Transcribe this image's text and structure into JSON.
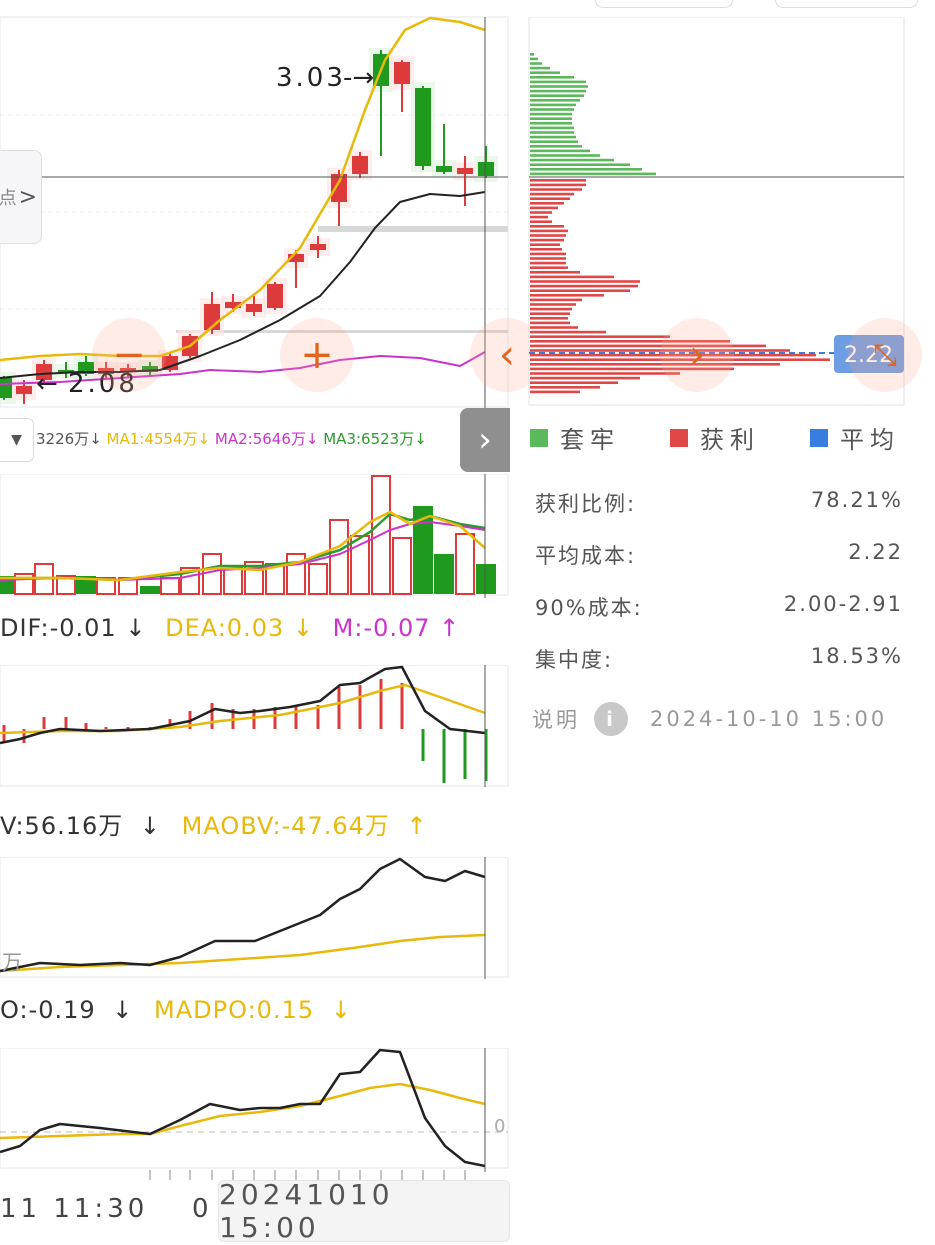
{
  "colors": {
    "up": "#dd3b3b",
    "down": "#1f9a1f",
    "ma_yellow": "#e8b90c",
    "ma_magenta": "#cc33cc",
    "ma_green": "#2e9a2e",
    "accent_orange": "#e0641e",
    "avg_blue": "#3a7de0",
    "chip_green": "#5bb85b",
    "chip_red": "#e04848"
  },
  "kline": {
    "high_label": "3.03",
    "low_label": "2.08",
    "chip_price_tag": "2.22"
  },
  "volume": {
    "vol_text": "3226万",
    "ma1_text": "MA1:4554万",
    "ma2_text": "MA2:5646万",
    "ma3_text": "MA3:6523万",
    "dropdown_icon": "triangle-down-icon"
  },
  "macd": {
    "dif": "DIF:-0.01",
    "dea": "DEA:0.03",
    "m": "M:-0.07"
  },
  "obv": {
    "obv": "V:56.16万",
    "maobv": "MAOBV:-47.64万",
    "unit_label": "万"
  },
  "dpo": {
    "dpo": "O:-0.19",
    "madpo": "MADPO:0.15",
    "zero_label": "0"
  },
  "side_tab_text": "点",
  "time_axis": {
    "left_label": "11 11:30",
    "mid_fragment": "0",
    "crosshair_label": "20241010 15:00"
  },
  "chip": {
    "legend": [
      {
        "label": "套牢",
        "color": "#5bb85b"
      },
      {
        "label": "获利",
        "color": "#e04848"
      },
      {
        "label": "平均",
        "color": "#3a7de0"
      }
    ],
    "stats": [
      {
        "label": "获利比例:",
        "value": "78.21%"
      },
      {
        "label": "平均成本:",
        "value": "2.22"
      },
      {
        "label": "90%成本:",
        "value": "2.00-2.91"
      },
      {
        "label": "集中度:",
        "value": "18.53%"
      }
    ],
    "note_label": "说明",
    "note_time": "2024-10-10 15:00"
  },
  "arrows": {
    "down": "↓",
    "up": "↑"
  }
}
